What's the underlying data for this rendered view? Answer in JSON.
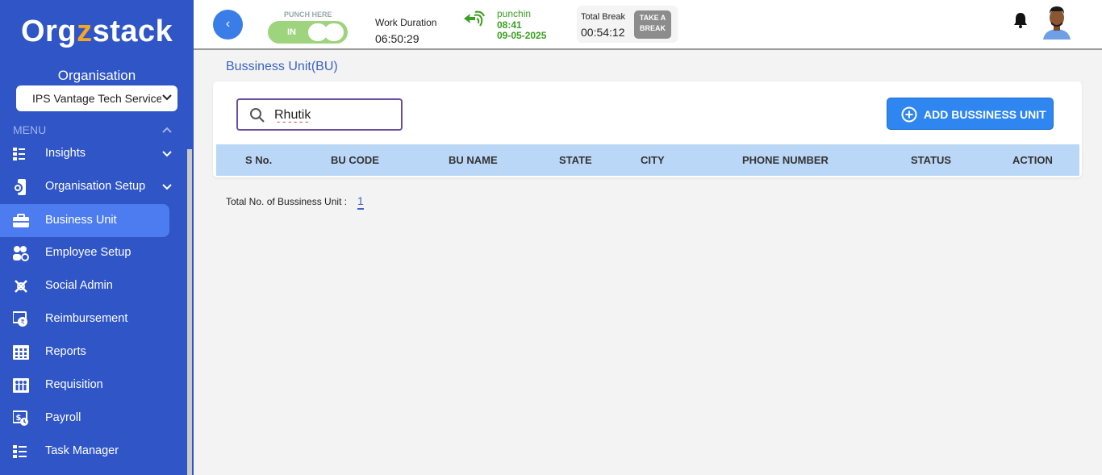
{
  "app": {
    "logo_text_prefix": "Org",
    "logo_text_z": "z",
    "logo_text_suffix": "stack",
    "brand_color": "#2f55c7",
    "accent_color": "#f5a623"
  },
  "sidebar": {
    "org_label": "Organisation",
    "org_selected": "IPS Vantage Tech Services",
    "menu_label": "MENU",
    "items": [
      {
        "label": "Insights",
        "icon": "insights-icon",
        "has_chevron": true,
        "active": false
      },
      {
        "label": "Organisation Setup",
        "icon": "org-setup-icon",
        "has_chevron": true,
        "active": false
      },
      {
        "label": "Business Unit",
        "icon": "briefcase-icon",
        "has_chevron": false,
        "active": true
      },
      {
        "label": "Employee Setup",
        "icon": "employee-setup-icon",
        "has_chevron": false,
        "active": false
      },
      {
        "label": "Social Admin",
        "icon": "social-admin-icon",
        "has_chevron": false,
        "active": false
      },
      {
        "label": "Reimbursement",
        "icon": "reimbursement-icon",
        "has_chevron": false,
        "active": false
      },
      {
        "label": "Reports",
        "icon": "reports-icon",
        "has_chevron": false,
        "active": false
      },
      {
        "label": "Requisition",
        "icon": "requisition-icon",
        "has_chevron": false,
        "active": false
      },
      {
        "label": "Payroll",
        "icon": "payroll-icon",
        "has_chevron": false,
        "active": false
      },
      {
        "label": "Task Manager",
        "icon": "task-manager-icon",
        "has_chevron": false,
        "active": false
      }
    ]
  },
  "header": {
    "punch_here_label": "PUNCH HERE",
    "toggle_label": "IN",
    "work_duration_label": "Work Duration",
    "work_duration_value": "06:50:29",
    "punch_status": "punchin",
    "punch_time": "08:41",
    "punch_date": "09-05-2025",
    "total_break_label": "Total Break",
    "total_break_value": "00:54:12",
    "take_break_line1": "TAKE A",
    "take_break_line2": "BREAK"
  },
  "main": {
    "page_title": "Bussiness Unit(BU)",
    "search_value": "Rhutik",
    "add_button_label": "ADD BUSSINESS UNIT",
    "columns": [
      "S No.",
      "BU CODE",
      "BU NAME",
      "STATE",
      "CITY",
      "PHONE NUMBER",
      "STATUS",
      "ACTION"
    ],
    "total_label": "Total No. of Bussiness Unit :",
    "total_value": "1"
  }
}
